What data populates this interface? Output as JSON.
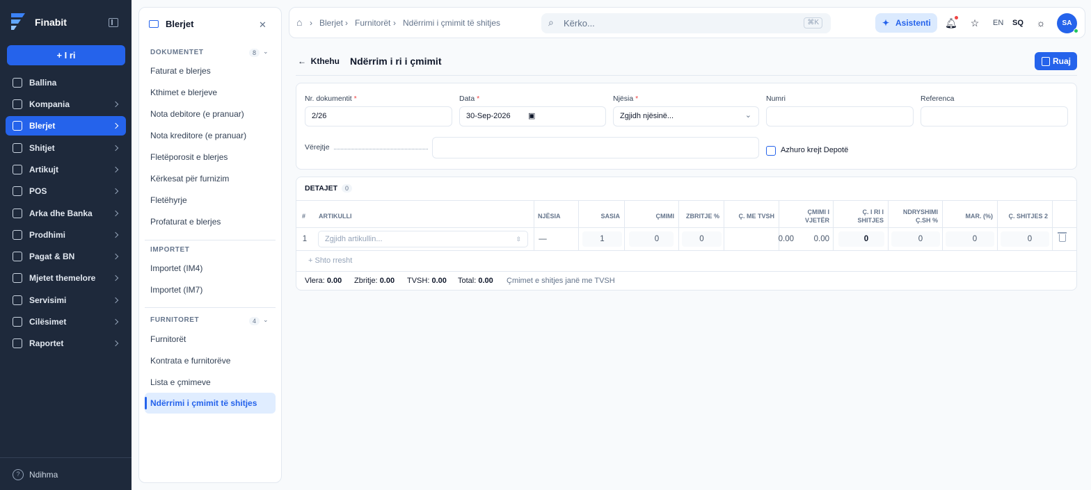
{
  "app": {
    "name": "Finabit",
    "new_label": "+ I ri",
    "help_label": "Ndihma"
  },
  "nav": {
    "items": [
      {
        "label": "Ballina",
        "icon": "dashboard-icon"
      },
      {
        "label": "Kompania",
        "icon": "building-icon"
      },
      {
        "label": "Blerjet",
        "icon": "truck-icon",
        "active": true
      },
      {
        "label": "Shitjet",
        "icon": "bag-icon"
      },
      {
        "label": "Artikujt",
        "icon": "box-icon"
      },
      {
        "label": "POS",
        "icon": "register-icon"
      },
      {
        "label": "Arka dhe Banka",
        "icon": "wallet-icon"
      },
      {
        "label": "Prodhimi",
        "icon": "factory-icon"
      },
      {
        "label": "Pagat & BN",
        "icon": "payroll-icon"
      },
      {
        "label": "Mjetet themelore",
        "icon": "asset-icon"
      },
      {
        "label": "Servisimi",
        "icon": "wrench-icon"
      },
      {
        "label": "Cilësimet",
        "icon": "gear-icon"
      },
      {
        "label": "Raportet",
        "icon": "chart-icon"
      }
    ]
  },
  "sub": {
    "title": "Blerjet",
    "sections": [
      {
        "title": "DOKUMENTET",
        "count": "8",
        "items": [
          "Faturat e blerjes",
          "Kthimet e blerjeve",
          "Nota debitore (e pranuar)",
          "Nota kreditore (e pranuar)",
          "Fletëporosit e blerjes",
          "Kërkesat për furnizim",
          "Fletëhyrje",
          "Profaturat e blerjes"
        ]
      },
      {
        "title": "IMPORTET",
        "items": [
          "Importet (IM4)",
          "Importet (IM7)"
        ]
      },
      {
        "title": "FURNITORET",
        "count": "4",
        "items": [
          "Furnitorët",
          "Kontrata e furnitorëve",
          "Lista e çmimeve"
        ],
        "active": "Ndërrimi i çmimit të shitjes"
      }
    ]
  },
  "header": {
    "breadcrumb": [
      "Blerjet",
      "Furnitorët",
      "Ndërrimi i çmimit të shitjes"
    ],
    "search_placeholder": "Kërko...",
    "search_shortcut": "⌘K",
    "assistant_label": "Asistenti",
    "lang_en": "EN",
    "lang_sq": "SQ",
    "avatar": "SA"
  },
  "page": {
    "back_label": "Kthehu",
    "title": "Ndërrim i ri i çmimit",
    "save_label": "Ruaj"
  },
  "form": {
    "doc_label": "Nr. dokumentit",
    "doc_value": "2/26",
    "date_label": "Data",
    "date_value": "30-Sep-2026",
    "unit_label": "Njësia",
    "unit_value": "Zgjidh njësinë...",
    "number_label": "Numri",
    "reference_label": "Referenca",
    "notes_label": "Vërejtje",
    "update_all_label": "Azhuro krejt Depotë"
  },
  "details": {
    "title": "DETAJET",
    "count": "0",
    "columns": [
      "#",
      "ARTIKULLI",
      "NJËSIA",
      "SASIA",
      "ÇMIMI",
      "ZBRITJE %",
      "Ç. ME TVSH",
      "ÇMIMI I VJETËR",
      "Ç. I RI I SHITJES",
      "NDRYSHIMI Ç.SH %",
      "MAR. (%)",
      "Ç. SHITJES 2"
    ],
    "row": {
      "num": "1",
      "article_placeholder": "Zgjidh artikullin...",
      "unit": "—",
      "qty": "1",
      "price": "0",
      "discount": "0",
      "price_vat": "0.00",
      "old_price": "0.00",
      "new_price": "0",
      "change": "0",
      "margin": "0",
      "price2": "0"
    },
    "add_row_label": "+ Shto rresht",
    "totals": {
      "value_label": "Vlera:",
      "value": "0.00",
      "discount_label": "Zbritje:",
      "discount": "0.00",
      "vat_label": "TVSH:",
      "vat": "0.00",
      "total_label": "Total:",
      "total": "0.00"
    },
    "note": "Çmimet e shitjes janë me TVSH"
  }
}
